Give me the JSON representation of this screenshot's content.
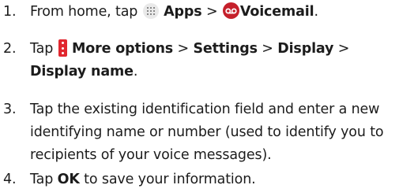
{
  "steps": [
    {
      "number": "1.",
      "parts": {
        "prefix": "From home, tap",
        "apps_label": "Apps",
        "sep": ">",
        "voicemail_label": "Voicemail",
        "end": "."
      },
      "icons": [
        "apps-grid-icon",
        "voicemail-icon"
      ]
    },
    {
      "number": "2.",
      "parts": {
        "prefix": "Tap",
        "more_options_label": "More options",
        "sep1": ">",
        "settings_label": "Settings",
        "sep2": ">",
        "display_label": "Display",
        "sep3": ">",
        "display_name_label": "Display name",
        "end": "."
      },
      "icons": [
        "more-options-icon"
      ]
    },
    {
      "number": "3.",
      "lines": [
        "Tap the existing identification field and enter a new",
        "identifying name or number (used to identify you to",
        "recipients of your voice messages)."
      ]
    },
    {
      "number": "4.",
      "parts": {
        "prefix": "Tap",
        "ok_label": "OK",
        "suffix": "to save your information."
      }
    }
  ],
  "colors": {
    "text": "#1c1c1c",
    "voicemail_icon": "#c5202b",
    "more_options_icon": "#e1272f",
    "apps_icon_bg": "#e9e9e9"
  }
}
